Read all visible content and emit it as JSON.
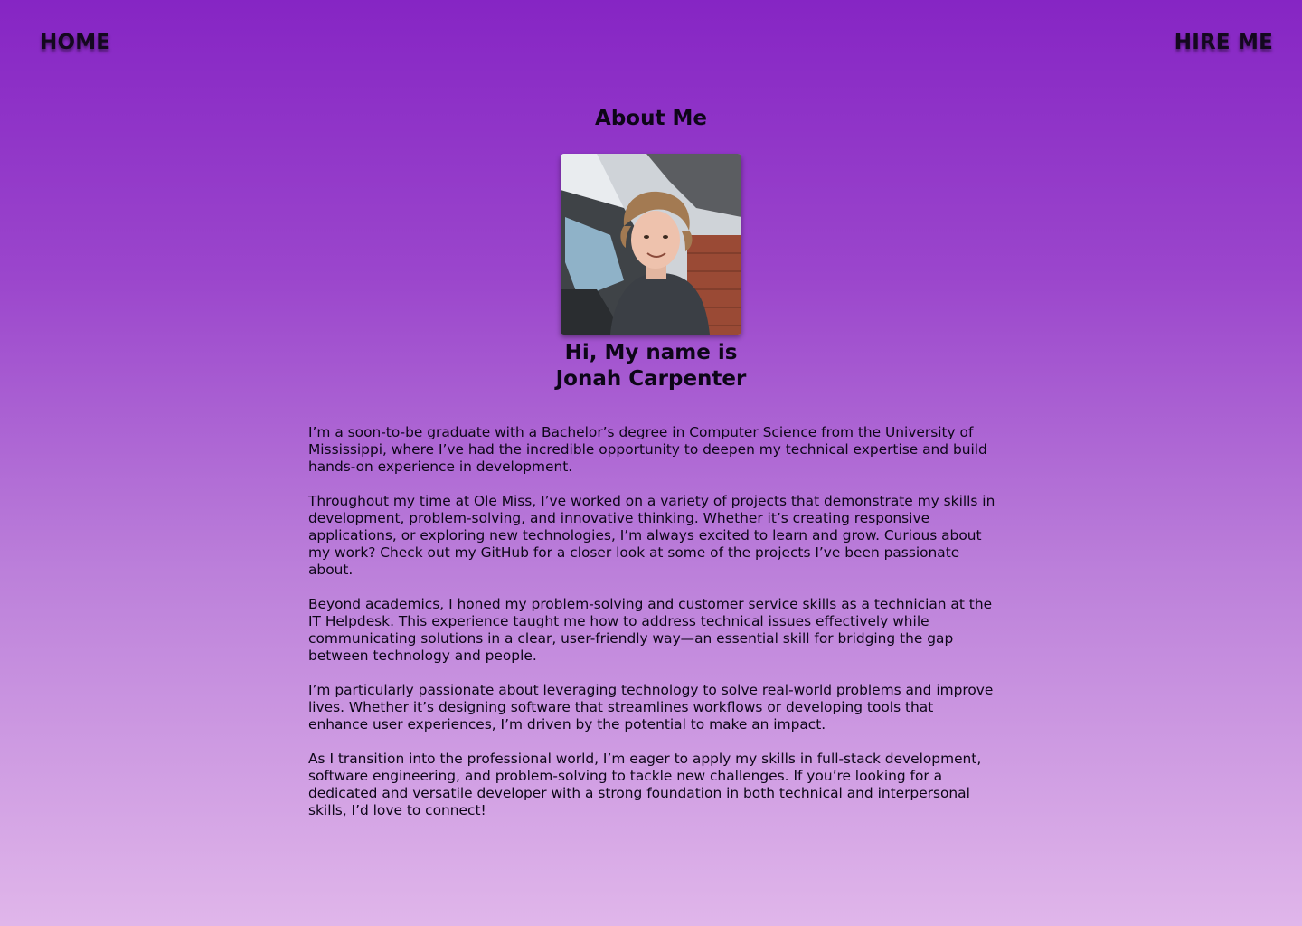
{
  "nav": {
    "home_label": "HOME",
    "hire_label": "HIRE ME"
  },
  "page": {
    "title": "About Me"
  },
  "profile": {
    "greeting_line1": "Hi, My name is",
    "greeting_line2": "Jonah Carpenter"
  },
  "bio": {
    "paragraphs": [
      "I’m a soon-to-be graduate with a Bachelor’s degree in Computer Science from the University of Mississippi, where I’ve had the incredible opportunity to deepen my technical expertise and build hands-on experience in development.",
      "Throughout my time at Ole Miss, I’ve worked on a variety of projects that demonstrate my skills in development, problem-solving, and innovative thinking. Whether it’s creating responsive applications, or exploring new technologies, I’m always excited to learn and grow. Curious about my work? Check out my GitHub for a closer look at some of the projects I’ve been passionate about.",
      "Beyond academics, I honed my problem-solving and customer service skills as a technician at the IT Helpdesk. This experience taught me how to address technical issues effectively while communicating solutions in a clear, user-friendly way—an essential skill for bridging the gap between technology and people.",
      "I’m particularly passionate about leveraging technology to solve real-world problems and improve lives. Whether it’s designing software that streamlines workflows or developing tools that enhance user experiences, I’m driven by the potential to make an impact.",
      "As I transition into the professional world, I’m eager to apply my skills in full-stack development, software engineering, and problem-solving to tackle new challenges. If you’re looking for a dedicated and versatile developer with a strong foundation in both technical and interpersonal skills, I’d love to connect!"
    ]
  },
  "colors": {
    "gradient_top": "#8625c4",
    "gradient_bottom": "#e0b6ea",
    "text": "#0d0618"
  }
}
